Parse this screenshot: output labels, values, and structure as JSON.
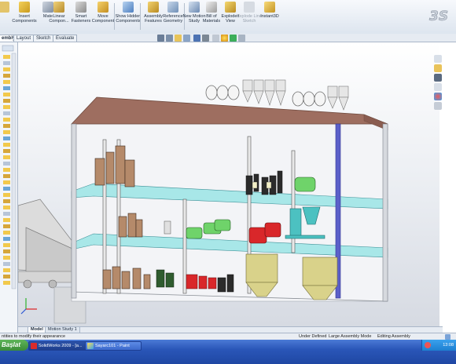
{
  "toolbar": {
    "items": [
      {
        "label": "Insert Components"
      },
      {
        "label": "Mate"
      },
      {
        "label": "Linear Compon..."
      },
      {
        "label": "Smart Fasteners"
      },
      {
        "label": "Move Component"
      },
      {
        "label": "Show Hidden Components"
      },
      {
        "label": "Assembly Features"
      },
      {
        "label": "Reference Geometry"
      },
      {
        "label": "New Motion Study"
      },
      {
        "label": "Bill of Materials"
      },
      {
        "label": "Exploded View"
      },
      {
        "label": "Explode Line Sketch"
      },
      {
        "label": "Instant3D"
      }
    ]
  },
  "tabs": [
    "embly",
    "Layout",
    "Sketch",
    "Evaluate"
  ],
  "model_tabs": [
    "Model",
    "Motion Study 1"
  ],
  "status": {
    "left": "ntities to modify their appearance",
    "state": "Under Defined",
    "mode": "Large Assembly Mode",
    "editing": "Editing Assembly"
  },
  "taskbar": {
    "start": "Başlat",
    "tasks": [
      "SolidWorks 2009 - [a...",
      "Sayarc101 - Paint"
    ],
    "clock": "13:08"
  },
  "icons": {
    "triad": "xyz-triad-icon",
    "logo": "ds-solidworks-logo-icon"
  },
  "colors": {
    "accent": "#2a56b8",
    "start_green": "#3a8c37",
    "roof": "#9e6e60",
    "glass_floor": "#8fe3e3",
    "machine_green": "#6fd36a",
    "machine_red": "#d9272a",
    "silo": "#d9d28a"
  }
}
